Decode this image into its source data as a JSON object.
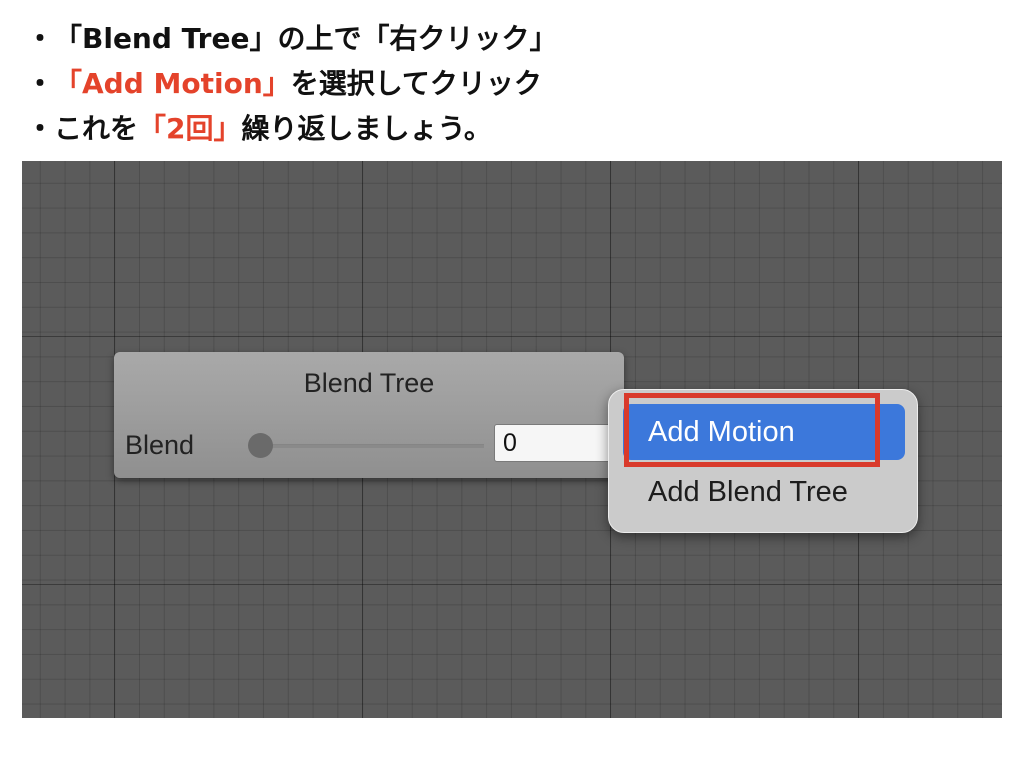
{
  "instructions": {
    "line1": {
      "bullet": "・",
      "text": "「Blend Tree」の上で「右クリック」"
    },
    "line2": {
      "bullet": "・",
      "highlight": "「Add Motion」",
      "rest": "を選択してクリック"
    },
    "line3": {
      "bullet": "・",
      "prefix": "これを",
      "highlight": "「2回」",
      "rest": "繰り返しましょう。"
    }
  },
  "node": {
    "title": "Blend Tree",
    "parameter_label": "Blend",
    "value": "0",
    "slider_level": 0
  },
  "context_menu": {
    "items": [
      {
        "label": "Add Motion",
        "selected": true
      },
      {
        "label": "Add Blend Tree",
        "selected": false
      }
    ]
  },
  "colors": {
    "highlight_text": "#e4432b",
    "highlight_box": "#d93a2b",
    "selected_item": "#3c78db",
    "canvas": "#5b5b5b"
  }
}
